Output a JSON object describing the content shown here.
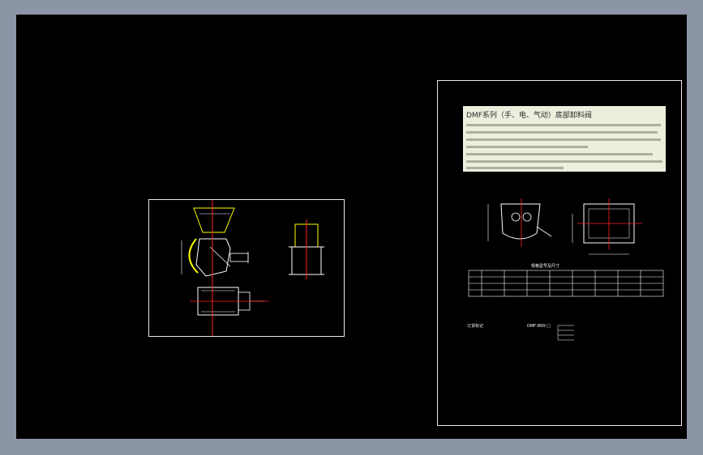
{
  "drawing": {
    "note_title": "DMF系列（手、电、气动）底部卸料阀",
    "table_title": "规格型号及尺寸",
    "order_label": "订货标记",
    "order_code": "DMF-800-□"
  },
  "colors": {
    "background": "#8b95a6",
    "canvas": "#000000",
    "frame": "#e8e8e8",
    "centerline": "#ff2020",
    "highlight": "#ffff00",
    "note_paper": "#eeeedf"
  }
}
